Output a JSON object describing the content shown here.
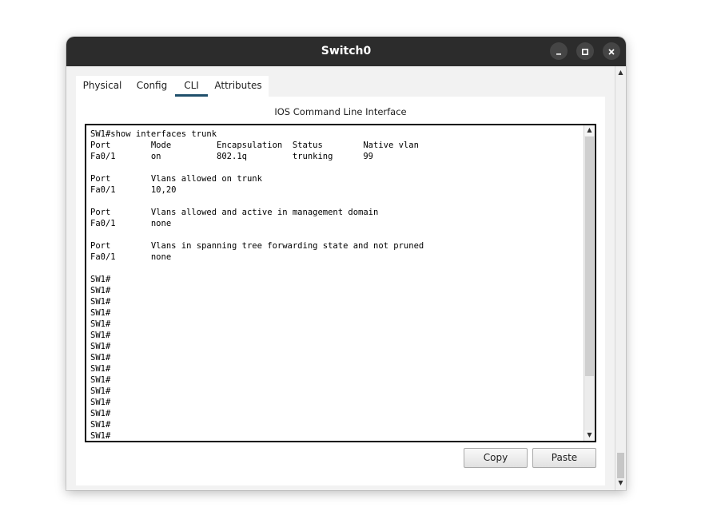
{
  "window": {
    "title": "Switch0",
    "controls": [
      "minimize-icon",
      "maximize-icon",
      "close-icon"
    ]
  },
  "tabs": [
    {
      "label": "Physical",
      "active": false
    },
    {
      "label": "Config",
      "active": false
    },
    {
      "label": "CLI",
      "active": true
    },
    {
      "label": "Attributes",
      "active": false
    }
  ],
  "panel": {
    "title": "IOS Command Line Interface"
  },
  "console": {
    "lines": [
      "SW1#show interfaces trunk",
      "Port        Mode         Encapsulation  Status        Native vlan",
      "Fa0/1       on           802.1q         trunking      99",
      "",
      "Port        Vlans allowed on trunk",
      "Fa0/1       10,20",
      "",
      "Port        Vlans allowed and active in management domain",
      "Fa0/1       none",
      "",
      "Port        Vlans in spanning tree forwarding state and not pruned",
      "Fa0/1       none",
      "",
      "SW1#",
      "SW1#",
      "SW1#",
      "SW1#",
      "SW1#",
      "SW1#",
      "SW1#",
      "SW1#",
      "SW1#",
      "SW1#",
      "SW1#",
      "SW1#",
      "SW1#",
      "SW1#",
      "SW1#"
    ]
  },
  "buttons": {
    "copy": "Copy",
    "paste": "Paste"
  },
  "colors": {
    "titlebar": "#2c2c2c",
    "active_tab_indicator": "#1f4f6b"
  }
}
